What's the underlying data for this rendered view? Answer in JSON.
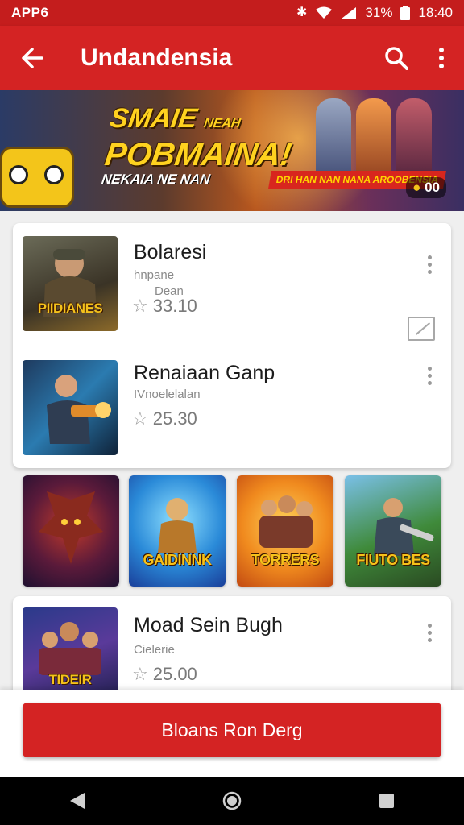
{
  "status_bar": {
    "left_text": "APP6",
    "battery_text": "31%",
    "time": "18:40",
    "icons": [
      "bluetooth-icon",
      "wifi-icon",
      "signal-icon",
      "battery-icon"
    ]
  },
  "app_bar": {
    "title": "Undandensia",
    "icons": [
      "back-arrow-icon",
      "search-icon",
      "more-vert-icon"
    ]
  },
  "banner": {
    "headline_line1": "SMAIE",
    "headline_small": "NEAH",
    "headline_line2": "POBMAINA!",
    "headline_line3": "NEKAIA NE NAN",
    "ribbon_text": "DRI HAN NAN NANA AROOBENSIA",
    "counter": "00"
  },
  "list_items": [
    {
      "name": "Bolaresi",
      "subtitle": "hnpane",
      "extra": "Dean",
      "rating": "33.10",
      "thumb_label": "PIIDIANES"
    },
    {
      "name": "Renaiaan Ganp",
      "subtitle": "IVnoelelalan",
      "rating": "25.30",
      "thumb_label": ""
    }
  ],
  "tiles": [
    {
      "label": "",
      "icon": "dragon-icon"
    },
    {
      "label": "GAIDINNK",
      "icon": "warrior-icon"
    },
    {
      "label": "TORRERS",
      "icon": "heroes-icon"
    },
    {
      "label": "FIUTO BES",
      "icon": "soldier-icon"
    }
  ],
  "third_item": {
    "name": "Moad Sein Bugh",
    "subtitle": "Cielerie",
    "rating": "25.00",
    "thumb_label": "TIDEIR"
  },
  "cta": {
    "label": "Bloans Ron Derg"
  },
  "colors": {
    "primary": "#d42323",
    "status": "#c41d1d"
  }
}
